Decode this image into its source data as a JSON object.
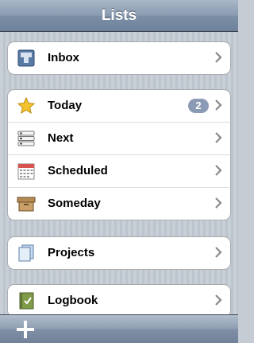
{
  "header": {
    "title": "Lists"
  },
  "groups": [
    {
      "items": [
        {
          "label": "Inbox",
          "icon": "inbox-icon"
        }
      ]
    },
    {
      "items": [
        {
          "label": "Today",
          "icon": "star-icon",
          "badge": "2"
        },
        {
          "label": "Next",
          "icon": "stack-icon"
        },
        {
          "label": "Scheduled",
          "icon": "calendar-icon"
        },
        {
          "label": "Someday",
          "icon": "box-icon"
        }
      ]
    },
    {
      "items": [
        {
          "label": "Projects",
          "icon": "projects-icon"
        }
      ]
    },
    {
      "items": [
        {
          "label": "Logbook",
          "icon": "logbook-icon"
        }
      ]
    }
  ],
  "toolbar": {
    "add_icon": "plus-icon"
  },
  "colors": {
    "navbar": "#7d8fa7",
    "badge": "#8c9bb5",
    "background": "#c5ccd4"
  }
}
